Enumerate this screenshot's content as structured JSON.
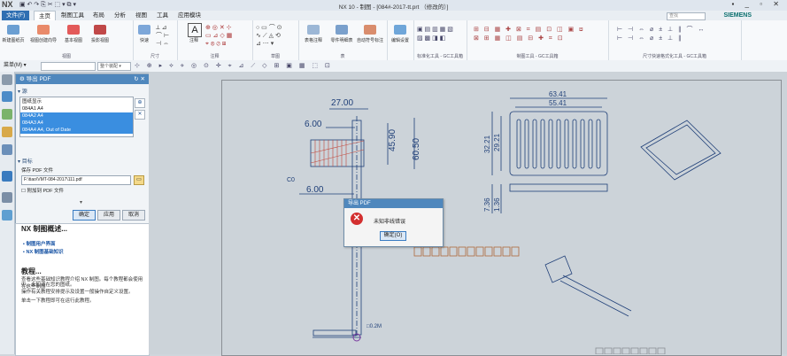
{
  "app": {
    "logo": "NX",
    "window_title": "NX 10 - 制图 - [084#-2017-tt.prt （修改的）]",
    "brand": "SIEMENS",
    "window_controls": "▪ _ ▫ ✕"
  },
  "tabs": [
    "文件(F)",
    "主页",
    "制图工具",
    "布局",
    "分析",
    "视图",
    "工具",
    "应用模块"
  ],
  "ribbon": {
    "groups": [
      {
        "label": "视图",
        "buttons": [
          "新建图纸页",
          "视图创建向导",
          "基本视图",
          "投影视图"
        ]
      },
      {
        "label": "尺寸",
        "buttons": [
          "快速"
        ]
      },
      {
        "label": "注释",
        "buttons": [
          "注释"
        ]
      },
      {
        "label": "草图",
        "buttons": []
      },
      {
        "label": "表",
        "buttons": [
          "表格注释",
          "零件明细表",
          "自动符号标注"
        ]
      },
      {
        "label": "",
        "buttons": [
          "编辑设置"
        ]
      },
      {
        "label": "标准化工具 - GC工具箱",
        "buttons": []
      },
      {
        "label": "制图工具 - GC工具箱",
        "buttons": []
      },
      {
        "label": "尺寸快速格式化工具 - GC工具箱",
        "buttons": []
      }
    ]
  },
  "cmdbar": {
    "menu_label": "菜单(M) ▾",
    "filter_placeholder": "",
    "scope_value": "整个装配 ▾"
  },
  "export_dialog": {
    "title": "导出 PDF",
    "section_sheets": "源",
    "list_header": "图纸显示",
    "sheets": [
      {
        "label": "084A1  A4",
        "selected": false
      },
      {
        "label": "084A2  A4",
        "selected": true
      },
      {
        "label": "084A3  A4",
        "selected": true
      },
      {
        "label": "084A4  A4, Out of Date",
        "selected": true
      }
    ],
    "section_target": "目标",
    "file_label": "保存 PDF 文件",
    "file_value": "F:\\tiao\\VMT-084-2017\\111.pdf",
    "append_label": "附加到 PDF 文件",
    "ok_label": "确定",
    "apply_label": "应用",
    "cancel_label": "取消"
  },
  "help_panel": {
    "title": "NX 制图概述...",
    "links": [
      "制图用户界面",
      "NX 制图基础知识"
    ],
    "tutorial_title": "教程...",
    "lines": [
      "查看这些基础知识教程介绍 NX 制图。每个教程都会使用在这些制图",
      "中。未知道在您的图纸。",
      "操作有关教程安排提示及设置一般操作自定义设置。",
      "单击一下教程即可在运行此教程。"
    ]
  },
  "drawing": {
    "dims": [
      "27.00",
      "6.00",
      "45.90",
      "60.50",
      "6.00",
      "63.41",
      "55.41",
      "32.21",
      "29.21",
      "7.36",
      "1.36",
      "□0.2M"
    ],
    "chamfer": "C0"
  },
  "error_dialog": {
    "title": "导出 PDF",
    "message": "未知非线错误",
    "ok_label": "确定(O)"
  },
  "colors": {
    "accent": "#4f87bd",
    "drawing_line": "#1f3f78",
    "hatch": "#c0473a",
    "error": "#d32f2f"
  }
}
